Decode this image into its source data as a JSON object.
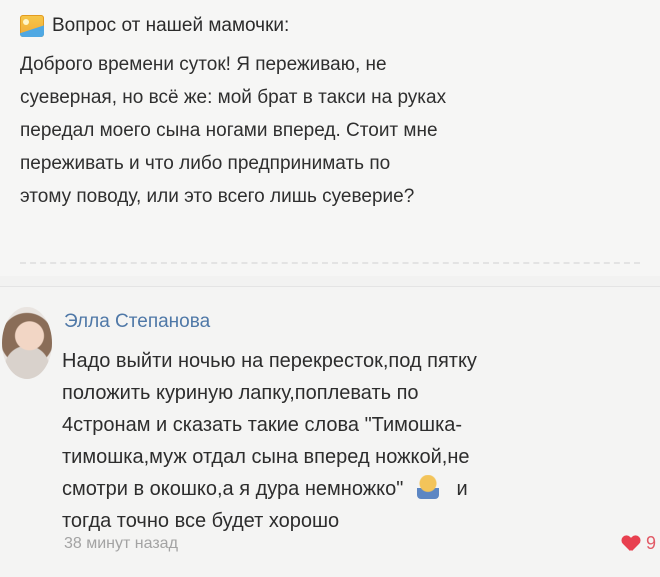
{
  "post": {
    "header_icon": "image-icon",
    "header_text": "Вопрос от нашей мамочки:",
    "lines": [
      "Доброго времени суток! Я переживаю, не",
      "суеверная, но всё же: мой брат в такси на руках",
      "передал моего сына   ногами вперед. Стоит мне",
      "переживать и что либо предпринимать по",
      "этому поводу, или это всего лишь суеверие?"
    ]
  },
  "comment": {
    "author": "Элла Степанова",
    "lines": [
      "Надо выйти ночью на перекресток,под пятку",
      "положить куриную лапку,поплевать по",
      "4стронам и сказать такие слова \"Тимошка-",
      "тимошка,муж отдал сына вперед ножкой,не",
      "смотри в окошко,а я дура немножко\"",
      "тогда точно все будет хорошо"
    ],
    "after_emoji": "и",
    "time": "38 минут назад",
    "likes": "9"
  }
}
